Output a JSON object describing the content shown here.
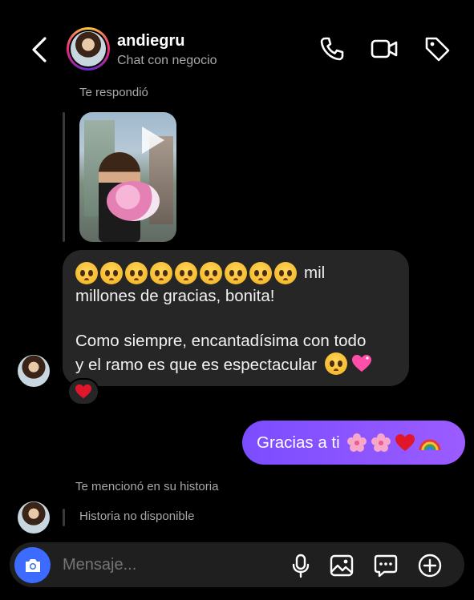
{
  "header": {
    "title": "andiegru",
    "subtitle": "Chat con negocio"
  },
  "thread": {
    "reply_label": "Te respondió",
    "incoming_message": {
      "line1_suffix": "mil",
      "line2": "millones de gracias, bonita!",
      "line3": "Como siempre, encantadísima con todo",
      "line4": "y el ramo es que es espectacular"
    },
    "outgoing_message": {
      "text": "Gracias a ti"
    },
    "mention_label": "Te mencionó en su historia",
    "story_unavailable": "Historia no disponible"
  },
  "composer": {
    "placeholder": "Mensaje..."
  },
  "colors": {
    "outgoing_bubble": "#8756ff",
    "camera_button": "#3d6bff",
    "incoming_bubble": "#262626"
  }
}
